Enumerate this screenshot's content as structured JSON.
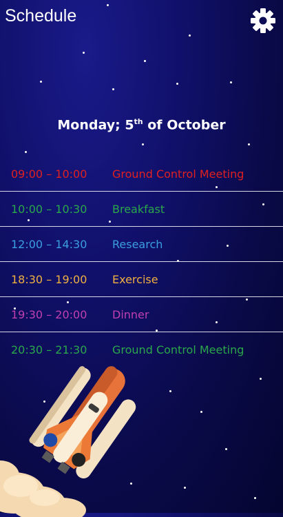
{
  "header": {
    "title": "Schedule",
    "settings_icon": "gear-icon"
  },
  "date": {
    "weekday": "Monday; 5",
    "suffix": "th",
    "rest": " of October"
  },
  "schedule": [
    {
      "time": "09:00 – 10:00",
      "event": "Ground Control Meeting",
      "color": "#e02020"
    },
    {
      "time": "10:00 – 10:30",
      "event": "Breakfast",
      "color": "#2aa84a"
    },
    {
      "time": "12:00 – 14:30",
      "event": "Research",
      "color": "#3b9ee0"
    },
    {
      "time": "18:30 – 19:00",
      "event": "Exercise",
      "color": "#f0b040"
    },
    {
      "time": "19:30 – 20:00",
      "event": "Dinner",
      "color": "#c040b0"
    },
    {
      "time": "20:30 – 21:30",
      "event": "Ground Control Meeting",
      "color": "#2aa84a"
    }
  ],
  "illustration": "rocket-illustration"
}
